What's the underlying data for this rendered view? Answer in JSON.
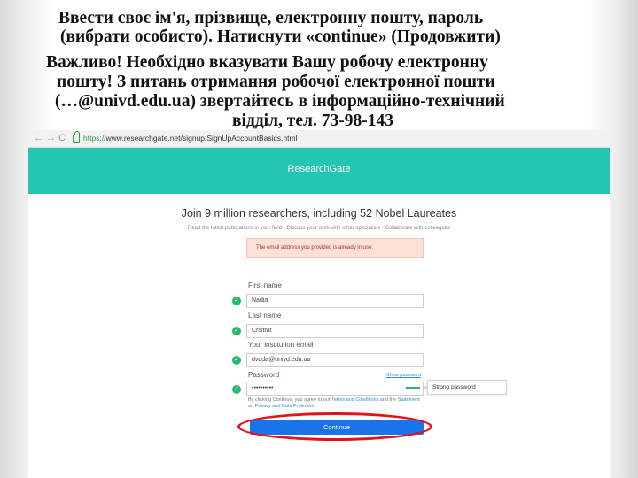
{
  "slide": {
    "lines": [
      "Ввести своє ім'я, прізвище, електронну пошту, пароль",
      "(вибрати особисто). Натиснути «continue» (Продовжити)",
      "Важливо! Необхідно вказувати Вашу робочу електронну",
      "пошту! З питань отримання робочої електронної пошти",
      "(…@univd.edu.ua) звертайтесь в інформаційно-технічний",
      "відділ, тел. 73-98-143"
    ]
  },
  "browser": {
    "nav_back": "←",
    "nav_forward": "→",
    "nav_reload": "C",
    "url_secure": "https://",
    "url_rest": "www.researchgate.net/signup.SignUpAccountBasics.html"
  },
  "page": {
    "logo": "ResearchGate",
    "headline": "Join 9 million researchers, including 52 Nobel Laureates",
    "subline": "Read the latest publications in your field • Discuss your work with other specialists • Collaborate with colleagues",
    "error_message": "The email address you provided is already in use.",
    "fields": {
      "first_name": {
        "label": "First name",
        "value": "Nadia"
      },
      "last_name": {
        "label": "Last name",
        "value": "Cristrat"
      },
      "email": {
        "label": "Your institution email",
        "value": "dvdda@univd.edu.ua"
      },
      "password": {
        "label": "Password",
        "value": "••••••••••"
      }
    },
    "show_password": "Show password",
    "strength_label": "Strong password",
    "terms_text": "By clicking Continue, you agree to our ",
    "terms_link": "Terms and Conditions",
    "terms_mid": " and the ",
    "privacy_link": "Statement on Privacy and Data Protection",
    "continue_label": "Continue"
  },
  "colors": {
    "brand": "#25c5b3",
    "button": "#1a73e8",
    "highlight_oval": "#e0141b",
    "valid_check": "#2bb673"
  },
  "icons": [
    "back-arrow-icon",
    "forward-arrow-icon",
    "reload-icon",
    "lock-icon",
    "check-icon"
  ]
}
